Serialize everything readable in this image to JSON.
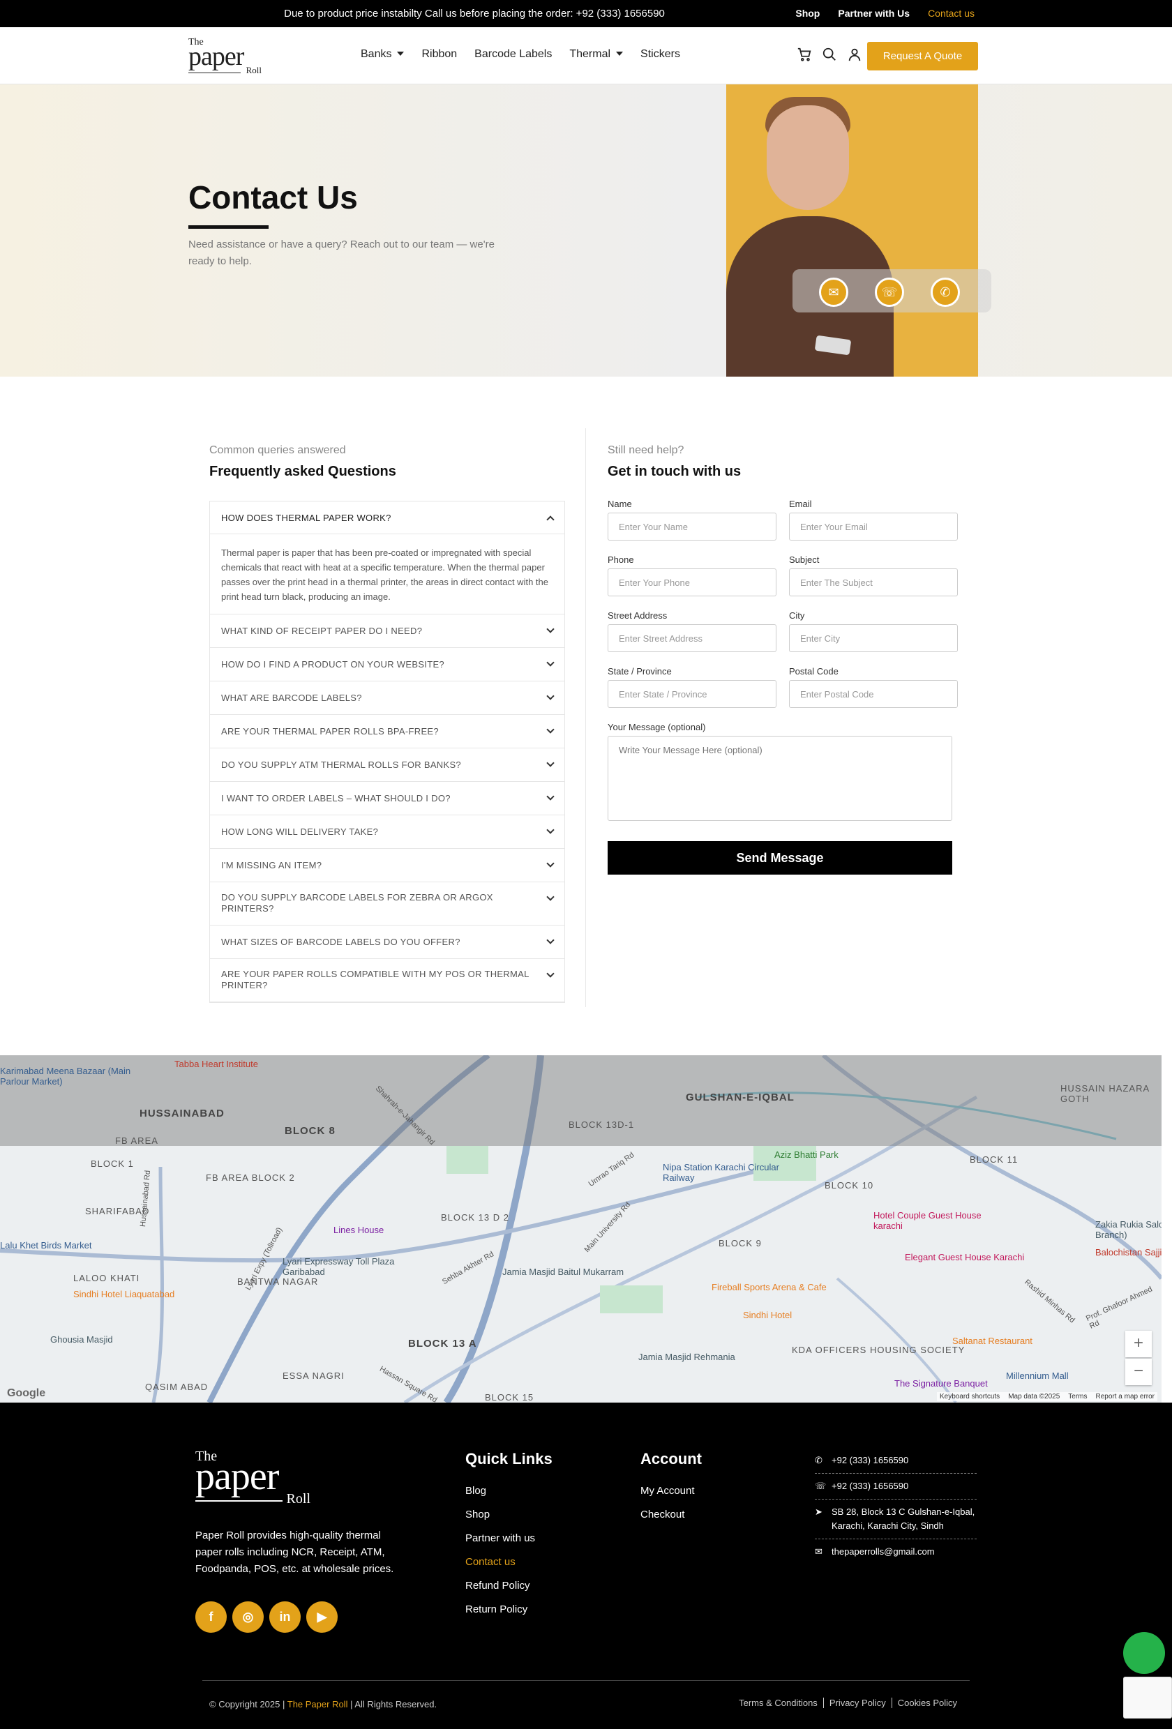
{
  "topbar": {
    "notice": "Due to product price instabilty Call us before placing the order: +92 (333) 1656590",
    "links": [
      "Shop",
      "Partner with Us",
      "Contact us"
    ]
  },
  "header": {
    "logo": {
      "the": "The",
      "paper": "paper",
      "roll": "Roll"
    },
    "nav": [
      "Banks",
      "Ribbon",
      "Barcode Labels",
      "Thermal",
      "Stickers"
    ],
    "icons": [
      "cart-icon",
      "search-icon",
      "user-icon"
    ],
    "quote_button": "Request A Quote"
  },
  "hero": {
    "title": "Contact Us",
    "subtitle": "Need assistance or have a query? Reach out to our team — we're ready to help.",
    "contact_icons": [
      "mail-icon",
      "whatsapp-icon",
      "phone-icon"
    ]
  },
  "faq": {
    "kicker": "Common queries answered",
    "title": "Frequently asked Questions",
    "items": [
      {
        "q": "HOW DOES THERMAL PAPER WORK?",
        "a": "Thermal paper is paper that has been pre-coated or impregnated with special chemicals that react with heat at a specific temperature. When the thermal paper passes over the print head in a thermal printer, the areas in direct contact with the print head turn black, producing an image.",
        "open": true
      },
      {
        "q": "WHAT KIND OF RECEIPT PAPER DO I NEED?"
      },
      {
        "q": "HOW DO I FIND A PRODUCT ON YOUR WEBSITE?"
      },
      {
        "q": "WHAT ARE BARCODE LABELS?"
      },
      {
        "q": "ARE YOUR THERMAL PAPER ROLLS BPA-FREE?"
      },
      {
        "q": "DO YOU SUPPLY ATM THERMAL ROLLS FOR BANKS?"
      },
      {
        "q": "I WANT TO ORDER LABELS – WHAT SHOULD I DO?"
      },
      {
        "q": "HOW LONG WILL DELIVERY TAKE?"
      },
      {
        "q": "I'M MISSING AN ITEM?"
      },
      {
        "q": "DO YOU SUPPLY BARCODE LABELS FOR ZEBRA OR ARGOX PRINTERS?"
      },
      {
        "q": "WHAT SIZES OF BARCODE LABELS DO YOU OFFER?"
      },
      {
        "q": "ARE YOUR PAPER ROLLS COMPATIBLE WITH MY POS OR THERMAL PRINTER?"
      }
    ]
  },
  "form": {
    "kicker": "Still need help?",
    "title": "Get in touch with us",
    "rows": [
      [
        {
          "label": "Name",
          "placeholder": "Enter Your Name"
        },
        {
          "label": "Email",
          "placeholder": "Enter Your Email"
        }
      ],
      [
        {
          "label": "Phone",
          "placeholder": "Enter Your Phone"
        },
        {
          "label": "Subject",
          "placeholder": "Enter The Subject"
        }
      ],
      [
        {
          "label": "Street Address",
          "placeholder": "Enter Street Address"
        },
        {
          "label": "City",
          "placeholder": "Enter City"
        }
      ],
      [
        {
          "label": "State / Province",
          "placeholder": "Enter State / Province"
        },
        {
          "label": "Postal Code",
          "placeholder": "Enter Postal Code"
        }
      ]
    ],
    "message_label": "Your Message (optional)",
    "message_placeholder": "Write Your Message Here (optional)",
    "send_label": "Send Message"
  },
  "map": {
    "areas": [
      "HUSSAINABAD",
      "BLOCK 8",
      "GULSHAN-E-IQBAL",
      "FB AREA",
      "BLOCK 1",
      "FB AREA BLOCK 2",
      "SHARIFABAD",
      "BLOCK 13 A",
      "ESSA NAGRI",
      "QASIM ABAD",
      "KDA OFFICERS HOUSING SOCIETY",
      "BLOCK 10",
      "BLOCK 11",
      "BLOCK 9",
      "BLOCK 13 D 2",
      "BLOCK 13D-1",
      "BLOCK 15",
      "BANTWA NAGAR",
      "LALOO KHATI",
      "HUSSAIN HAZARA GOTH"
    ],
    "pois": [
      "Tabba Heart Institute",
      "Karimabad Meena Bazaar (Main Parlour Market)",
      "Nipa Station Karachi Circular Railway",
      "Aziz Bhatti Park",
      "Hotel Couple Guest House karachi",
      "Elegant Guest House Karachi",
      "Lines House",
      "Lyari Expressway Toll Plaza Garibabad",
      "Jamia Masjid Baitul Mukarram",
      "Fireball Sports Arena & Cafe",
      "Sindhi Hotel",
      "Sindhi Hotel Liaquatabad",
      "Jamia Masjid Rehmania",
      "Saltanat Restaurant",
      "The Signature Banquet",
      "Millennium Mall",
      "Balochistan Sajji",
      "Zakia Rukia Salon & Spa (Johar Branch)",
      "Ghousia Masjid",
      "Lalu Khet Birds Market"
    ],
    "roads": [
      "Lyari Expy (Tollroad)",
      "Umrao Tariq Rd",
      "Main University Rd",
      "Rashid Minhas Rd",
      "Shahrah-e-Jahangir Rd",
      "Hassan Square Rd",
      "Sehba Akhter Rd",
      "Prof. Ghafoor Ahmed Rd",
      "Hussainabad Rd"
    ],
    "attribution": [
      "Keyboard shortcuts",
      "Map data ©2025",
      "Terms",
      "Report a map error"
    ],
    "google": "Google",
    "zoom_in": "+",
    "zoom_out": "−"
  },
  "footer": {
    "logo": {
      "the": "The",
      "paper": "paper",
      "roll": "Roll"
    },
    "description": "Paper Roll provides high-quality thermal paper rolls including NCR, Receipt, ATM, Foodpanda, POS, etc. at wholesale prices.",
    "socials": [
      "facebook-icon",
      "instagram-icon",
      "linkedin-icon",
      "youtube-icon"
    ],
    "quick_links_title": "Quick Links",
    "quick_links": [
      "Blog",
      "Shop",
      "Partner with us",
      "Contact us",
      "Refund Policy",
      "Return Policy"
    ],
    "account_title": "Account",
    "account_links": [
      "My Account",
      "Checkout"
    ],
    "contact": [
      {
        "icon": "phone-icon",
        "text": "+92 (333) 1656590"
      },
      {
        "icon": "whatsapp-icon",
        "text": "+92 (333) 1656590"
      },
      {
        "icon": "location-arrow-icon",
        "text": "SB 28, Block 13 C Gulshan-e-Iqbal, Karachi, Karachi City, Sindh"
      },
      {
        "icon": "envelope-icon",
        "text": "thepaperrolls@gmail.com"
      }
    ],
    "copyright_prefix": "© Copyright 2025 |",
    "copyright_brand": "The Paper Roll",
    "copyright_suffix": "| All Rights Reserved.",
    "legal": [
      "Terms & Conditions",
      "Privacy Policy",
      "Cookies Policy"
    ]
  },
  "colors": {
    "accent": "#e3a21a",
    "dark": "#000000"
  }
}
